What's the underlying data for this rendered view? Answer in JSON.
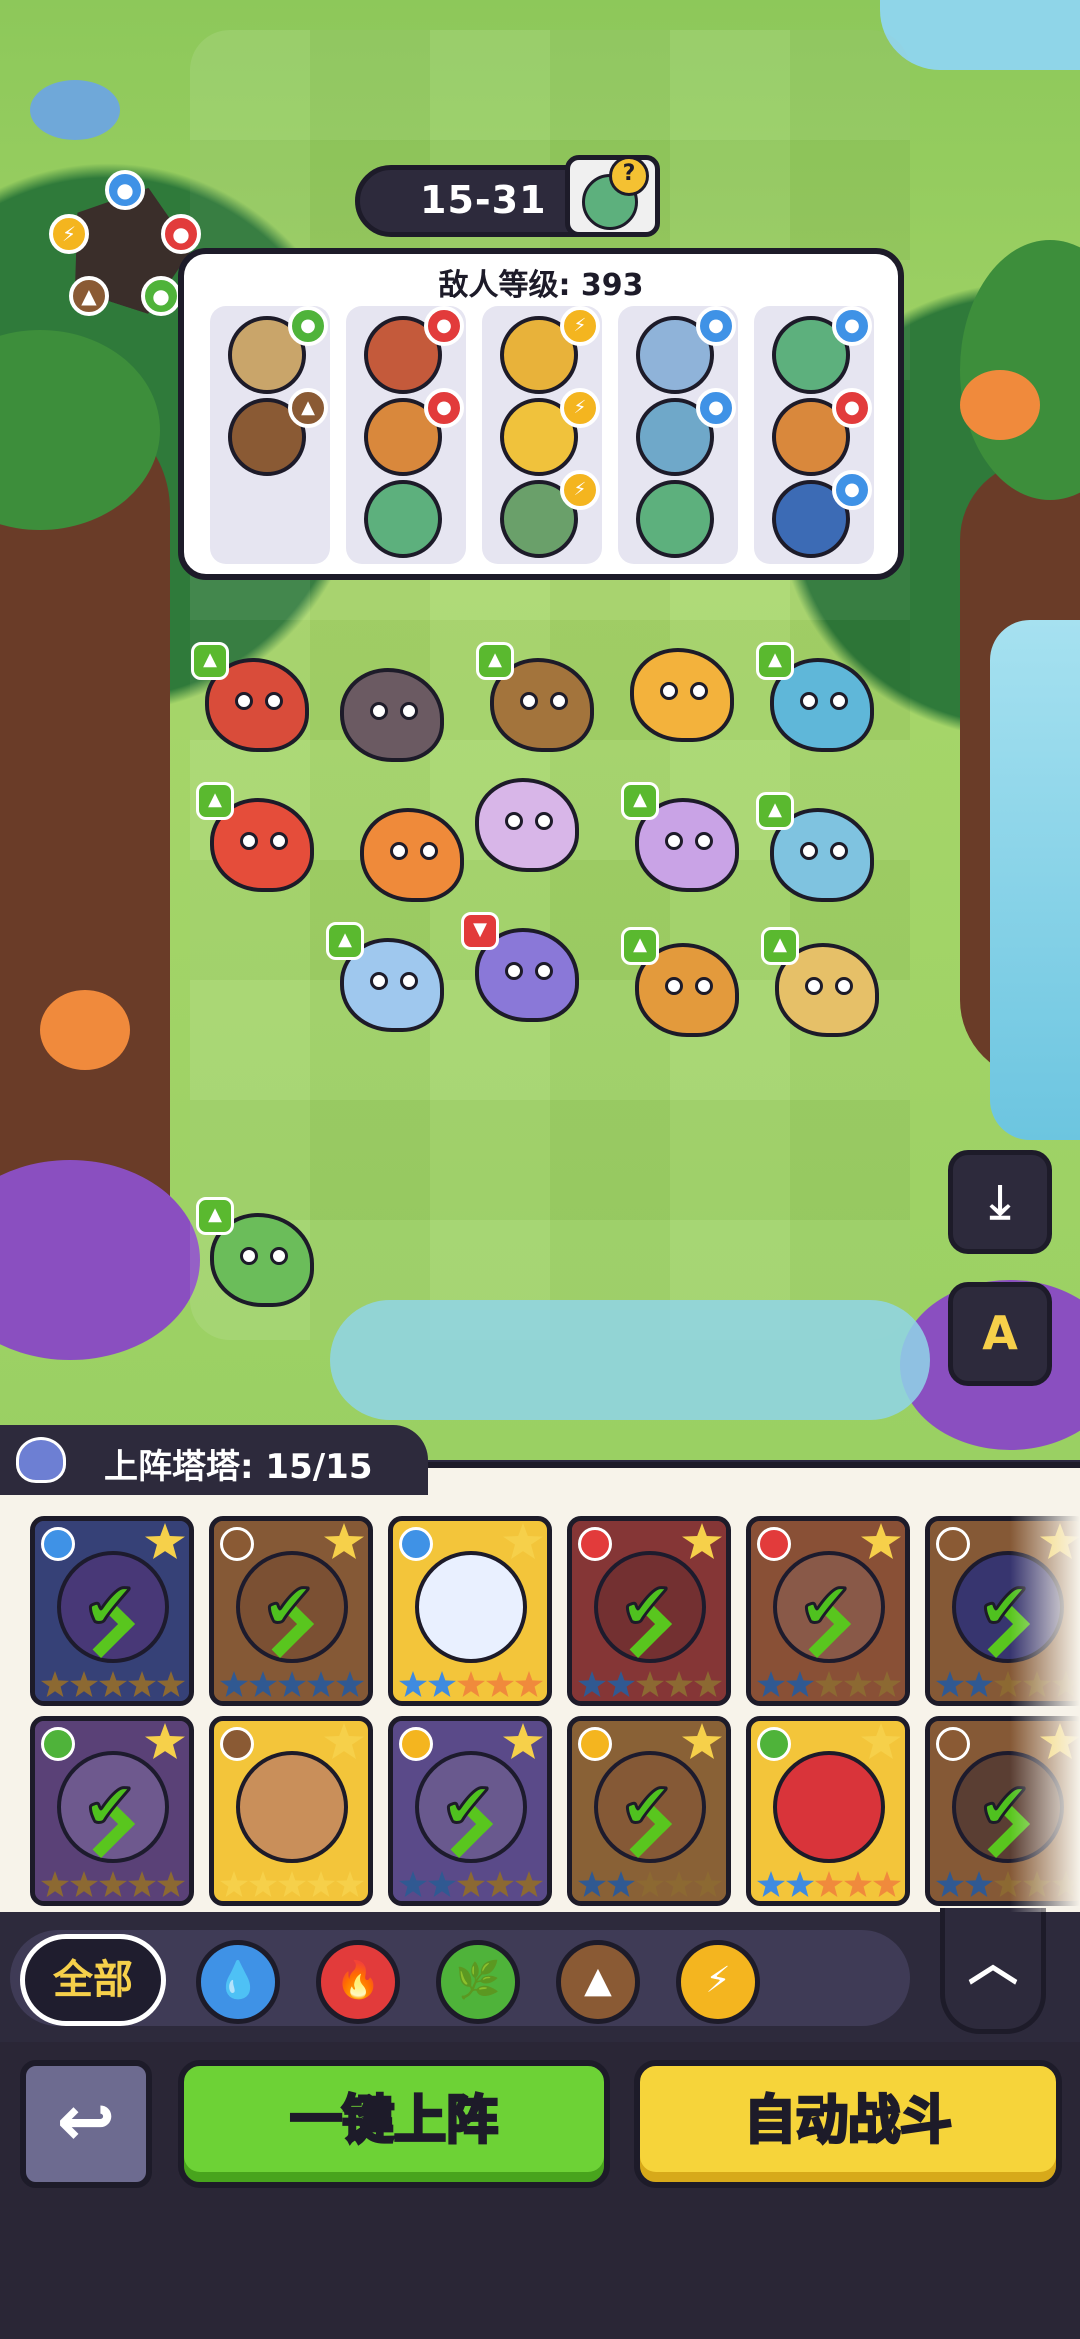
{
  "colors": {
    "water": "#3f92e6",
    "fire": "#e23b3b",
    "nature": "#4fb33a",
    "earth": "#8a5a34",
    "lightning": "#f4b51f",
    "panel_dark": "#2d2a3c",
    "deploy_green": "#6dd236",
    "auto_yellow": "#f6d43a"
  },
  "stage": {
    "label": "15-31",
    "hint_icon": "zombie-question-icon"
  },
  "element_wheel": {
    "elements": [
      "water",
      "fire",
      "nature",
      "earth",
      "lightning"
    ]
  },
  "enemy_panel": {
    "level_text": "敌人等级: 393",
    "columns": [
      {
        "units": [
          {
            "el": "nature",
            "color": "#c9a56a"
          },
          {
            "el": "earth",
            "color": "#8a5a34"
          }
        ]
      },
      {
        "units": [
          {
            "el": "fire",
            "color": "#c45a3b"
          },
          {
            "el": "fire",
            "color": "#d9883c"
          },
          {
            "el": "",
            "color": "#5db07d"
          }
        ]
      },
      {
        "units": [
          {
            "el": "lightning",
            "color": "#e8b23a"
          },
          {
            "el": "lightning",
            "color": "#f0c23c"
          },
          {
            "el": "lightning",
            "color": "#6aa06a"
          }
        ]
      },
      {
        "units": [
          {
            "el": "water",
            "color": "#8fb3d9"
          },
          {
            "el": "water",
            "color": "#6fa8c9"
          },
          {
            "el": "",
            "color": "#5db07d"
          }
        ]
      },
      {
        "units": [
          {
            "el": "water",
            "color": "#5db07d"
          },
          {
            "el": "fire",
            "color": "#d9883c"
          },
          {
            "el": "water",
            "color": "#3c6bb5"
          }
        ]
      }
    ]
  },
  "field_units": [
    {
      "name": "fire-boar",
      "color": "#d94c3a",
      "thumb": "up"
    },
    {
      "name": "dark-lizard",
      "color": "#6b5a62",
      "thumb": ""
    },
    {
      "name": "rock-turtle",
      "color": "#a3743c",
      "thumb": "up"
    },
    {
      "name": "golden-lion",
      "color": "#f3b23c",
      "thumb": ""
    },
    {
      "name": "ice-hedgehog",
      "color": "#5fb7d9",
      "thumb": "up"
    },
    {
      "name": "flame-parrot",
      "color": "#e54d3a",
      "thumb": "up"
    },
    {
      "name": "fire-bunny",
      "color": "#ef8a3a",
      "thumb": ""
    },
    {
      "name": "mantis-fairy",
      "color": "#d8b6e8",
      "thumb": ""
    },
    {
      "name": "purple-sheep",
      "color": "#c9a3e6",
      "thumb": "up"
    },
    {
      "name": "blue-fox",
      "color": "#7fc3e0",
      "thumb": "up"
    },
    {
      "name": "ice-serpent",
      "color": "#9fc8ee",
      "thumb": "up"
    },
    {
      "name": "crystal-dragon",
      "color": "#8a78d8",
      "thumb": "down"
    },
    {
      "name": "fox-dog",
      "color": "#e39a3c",
      "thumb": "up"
    },
    {
      "name": "sand-pug",
      "color": "#e6c068",
      "thumb": "up"
    },
    {
      "name": "mushroom-frog",
      "color": "#6bbd5a",
      "thumb": "up"
    }
  ],
  "side_buttons": {
    "download_icon": "download-icon",
    "text_settings_label": "A"
  },
  "tower_tab": {
    "text": "上阵塔塔: 15/15"
  },
  "cards": [
    {
      "el": "water",
      "bg": "#4a5fb0",
      "art": "#6b4fb0",
      "dim": true,
      "checked": true,
      "stars": [
        "#e6a832",
        "#e6a832",
        "#e6a832",
        "#e6a832",
        "#e6a832"
      ]
    },
    {
      "el": "earth",
      "bg": "#d98b3a",
      "art": "#c77b34",
      "dim": true,
      "checked": true,
      "stars": [
        "#3f8be0",
        "#3f8be0",
        "#3f8be0",
        "#3f8be0",
        "#3f8be0"
      ]
    },
    {
      "el": "water",
      "bg": "#f3c53a",
      "art": "#e9f0ff",
      "dim": false,
      "checked": false,
      "stars": [
        "#3f8be0",
        "#3f8be0",
        "#f08a3c",
        "#f08a3c",
        "#f08a3c"
      ]
    },
    {
      "el": "fire",
      "bg": "#d94c3a",
      "art": "#b84030",
      "dim": true,
      "checked": true,
      "stars": [
        "#3f8be0",
        "#3f8be0",
        "#e6a832",
        "#e6a832",
        "#e6a832"
      ]
    },
    {
      "el": "fire",
      "bg": "#e07a3a",
      "art": "#e08a5a",
      "dim": true,
      "checked": true,
      "stars": [
        "#3f8be0",
        "#3f8be0",
        "#e6a832",
        "#e6a832",
        "#e6a832"
      ]
    },
    {
      "el": "earth",
      "bg": "#d98b3a",
      "art": "#4b4aa0",
      "dim": true,
      "checked": true,
      "stars": [
        "#3f8be0",
        "#3f8be0",
        "#e6a832",
        "#e6a832",
        "#e6a832"
      ]
    },
    {
      "el": "nature",
      "bg": "#8a5fb0",
      "art": "#b08ad9",
      "dim": true,
      "checked": true,
      "stars": [
        "#e6a832",
        "#e6a832",
        "#e6a832",
        "#e6a832",
        "#e6a832"
      ]
    },
    {
      "el": "earth",
      "bg": "#f3c53a",
      "art": "#c98f5a",
      "dim": false,
      "checked": false,
      "stars": [
        "#f6d04a",
        "#f6d04a",
        "#f6d04a",
        "#f6d04a",
        "#f6d04a"
      ]
    },
    {
      "el": "lightning",
      "bg": "#8a6fd0",
      "art": "#a68ad9",
      "dim": true,
      "checked": true,
      "stars": [
        "#3f8be0",
        "#3f8be0",
        "#e6a832",
        "#e6a832",
        "#e6a832"
      ]
    },
    {
      "el": "lightning",
      "bg": "#e09a3a",
      "art": "#d98b3a",
      "dim": true,
      "checked": true,
      "stars": [
        "#3f8be0",
        "#3f8be0",
        "#e6a832",
        "#e6a832",
        "#e6a832"
      ]
    },
    {
      "el": "nature",
      "bg": "#f3c53a",
      "art": "#d9343a",
      "dim": false,
      "checked": false,
      "stars": [
        "#3f8be0",
        "#3f8be0",
        "#f08a3c",
        "#f08a3c",
        "#f08a3c"
      ]
    },
    {
      "el": "earth",
      "bg": "#d98b3a",
      "art": "#8a5a34",
      "dim": true,
      "checked": true,
      "stars": [
        "#3f8be0",
        "#3f8be0",
        "#e6a832",
        "#e6a832",
        "#e6a832"
      ]
    }
  ],
  "filters": {
    "all_label": "全部",
    "elements": [
      {
        "el": "water",
        "glyph": "💧"
      },
      {
        "el": "fire",
        "glyph": "🔥"
      },
      {
        "el": "nature",
        "glyph": "🌿"
      },
      {
        "el": "earth",
        "glyph": "▲"
      },
      {
        "el": "lightning",
        "glyph": "⚡"
      }
    ],
    "collapse_icon": "chevron-up-icon"
  },
  "actions": {
    "back_icon": "back-arrow-icon",
    "deploy_label": "一键上阵",
    "auto_battle_label": "自动战斗"
  }
}
